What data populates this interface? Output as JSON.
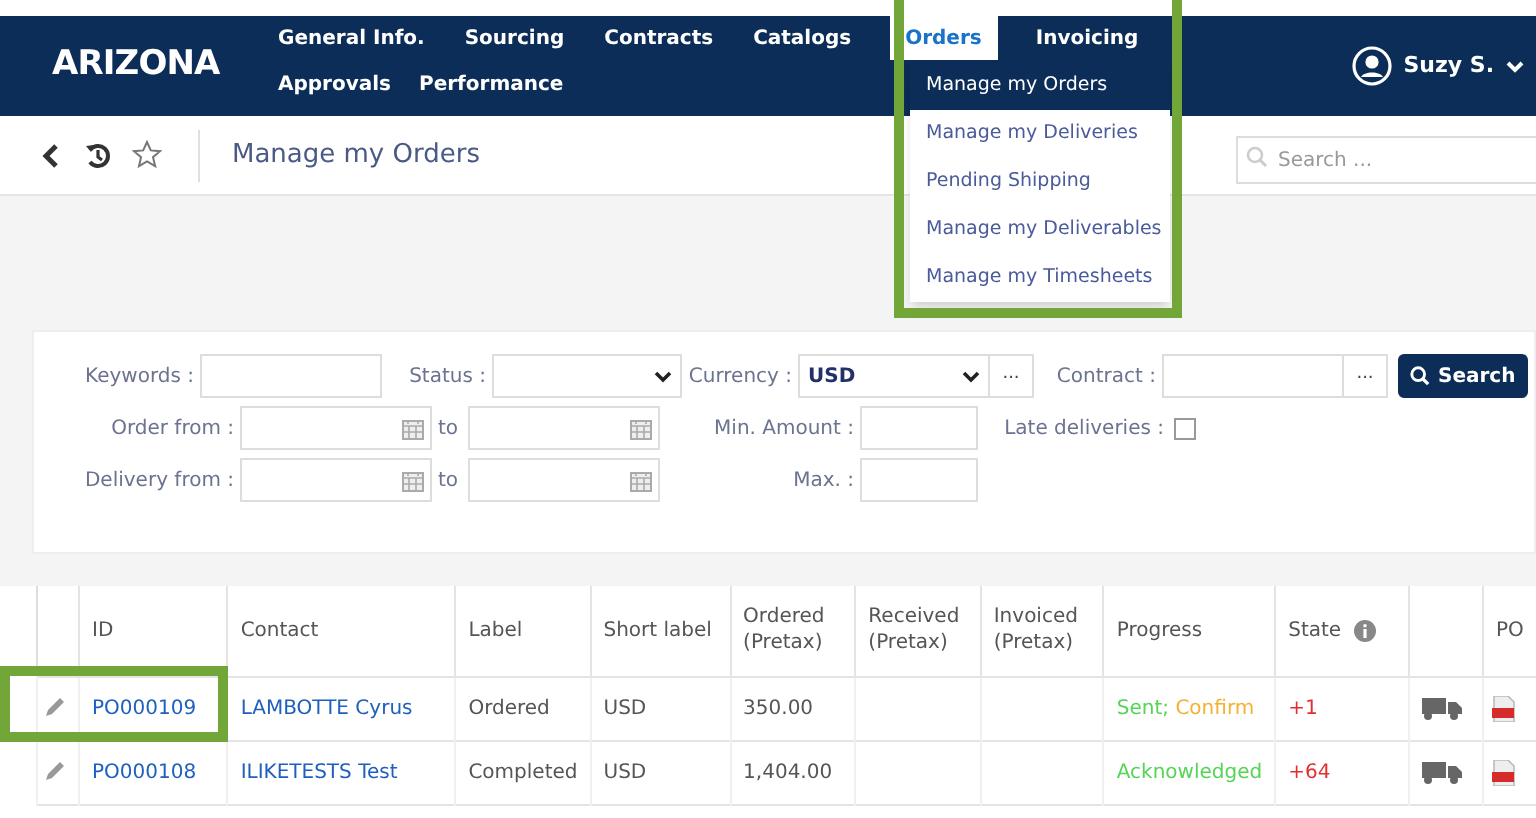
{
  "header": {
    "logo": "ARIZONA",
    "nav_row1": [
      {
        "label": "General Info.",
        "selected": false
      },
      {
        "label": "Sourcing",
        "selected": false
      },
      {
        "label": "Contracts",
        "selected": false
      },
      {
        "label": "Catalogs",
        "selected": false
      },
      {
        "label": "Orders",
        "selected": true
      },
      {
        "label": "Invoicing",
        "selected": false
      }
    ],
    "nav_row2": [
      {
        "label": "Approvals",
        "selected": false
      },
      {
        "label": "Performance",
        "selected": false
      }
    ],
    "user": "Suzy S."
  },
  "orders_menu": [
    {
      "label": "Manage my Orders",
      "selected": true
    },
    {
      "label": "Manage my Deliveries",
      "selected": false
    },
    {
      "label": "Pending Shipping",
      "selected": false
    },
    {
      "label": "Manage my Deliverables",
      "selected": false
    },
    {
      "label": "Manage my Timesheets",
      "selected": false
    }
  ],
  "breadcrumb": {
    "title": "Manage my Orders",
    "search_placeholder": "Search ..."
  },
  "filters": {
    "keywords": "Keywords :",
    "status": "Status :",
    "currency": "Currency :",
    "currency_value": "USD",
    "more": "...",
    "contract": "Contract :",
    "contract_more": "...",
    "search_button": "Search",
    "order_from": "Order from :",
    "to1": "to",
    "min_amount": "Min. Amount :",
    "late_deliveries": "Late deliveries :",
    "late_checked": false,
    "delivery_from": "Delivery from :",
    "to2": "to",
    "max": "Max. :"
  },
  "table": {
    "columns": [
      "ID",
      "Contact",
      "Label",
      "Short label",
      "Ordered (Pretax)",
      "Received (Pretax)",
      "Invoiced (Pretax)",
      "Progress",
      "State",
      "PO"
    ],
    "rows": [
      {
        "id": "PO000109",
        "contact": "LAMBOTTE Cyrus",
        "label": "Ordered",
        "short_label": "USD",
        "ordered": "350.00",
        "progress": [
          {
            "text": "Sent;",
            "color": "#55d455"
          },
          {
            "text": "Confirm",
            "color": "#f2b233"
          }
        ],
        "state": "+1"
      },
      {
        "id": "PO000108",
        "contact": "ILIKETESTS Test",
        "label": "Completed",
        "short_label": "USD",
        "ordered": "1,404.00",
        "progress": [
          {
            "text": "Acknowledged",
            "color": "#55d455"
          }
        ],
        "state": "+64"
      }
    ]
  }
}
